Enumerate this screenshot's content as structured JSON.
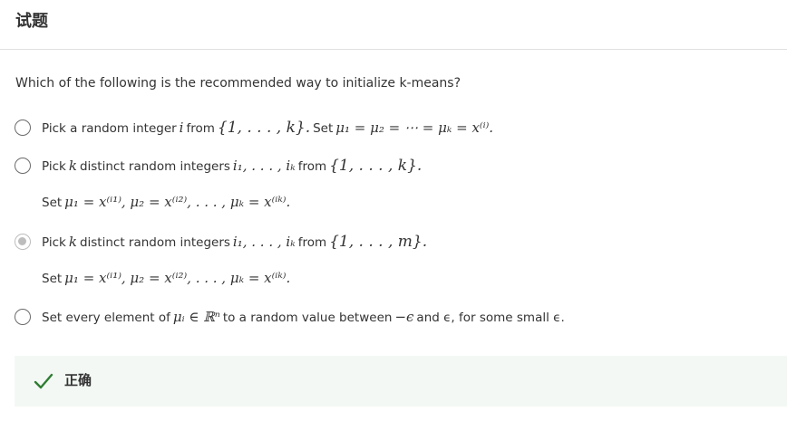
{
  "header": {
    "title": "试题"
  },
  "question": {
    "text": "Which of the following is the recommended way to initialize k-means?"
  },
  "options": [
    {
      "selected": false,
      "part1": "Pick a random integer",
      "math1": "i",
      "part2": "from",
      "math2": "{1, . . . , k}.",
      "part3": "Set",
      "math3": "μ₁ = μ₂ = ⋯ = μₖ = x⁽ⁱ⁾."
    },
    {
      "selected": false,
      "part1": "Pick",
      "math1": "k",
      "part2": "distinct random integers",
      "math2": "i₁, . . . , iₖ",
      "part3": "from",
      "math3": "{1, . . . , k}.",
      "line2_label": "Set",
      "line2_math": "μ₁ = x⁽ⁱ¹⁾, μ₂ = x⁽ⁱ²⁾, . . . , μₖ = x⁽ⁱᵏ⁾."
    },
    {
      "selected": true,
      "part1": "Pick",
      "math1": "k",
      "part2": "distinct random integers",
      "math2": "i₁, . . . , iₖ",
      "part3": "from",
      "math3": "{1, . . . , m}.",
      "line2_label": "Set",
      "line2_math": "μ₁ = x⁽ⁱ¹⁾, μ₂ = x⁽ⁱ²⁾, . . . , μₖ = x⁽ⁱᵏ⁾."
    },
    {
      "selected": false,
      "part1": "Set every element of",
      "math1": "μᵢ ∈ ℝⁿ",
      "part2": "to a random value between",
      "math2": "−ϵ",
      "part3": "and ϵ, for some small ϵ."
    }
  ],
  "result": {
    "label": "正确",
    "icon": "check-icon",
    "color": "#2e7d32"
  }
}
